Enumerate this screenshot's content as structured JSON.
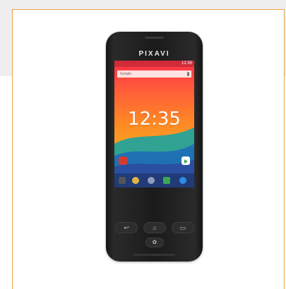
{
  "phone": {
    "brand": "PIXAVI",
    "status_time": "12:35",
    "search_label": "Google",
    "clock": "12:35",
    "keys": {
      "back": "↩",
      "home": "⌂",
      "recent": "▭",
      "center": "✿"
    }
  },
  "colors": {
    "frame_border": "#f0a04a",
    "band": "#eeeeee",
    "phone_body": "#1b1b1b"
  }
}
